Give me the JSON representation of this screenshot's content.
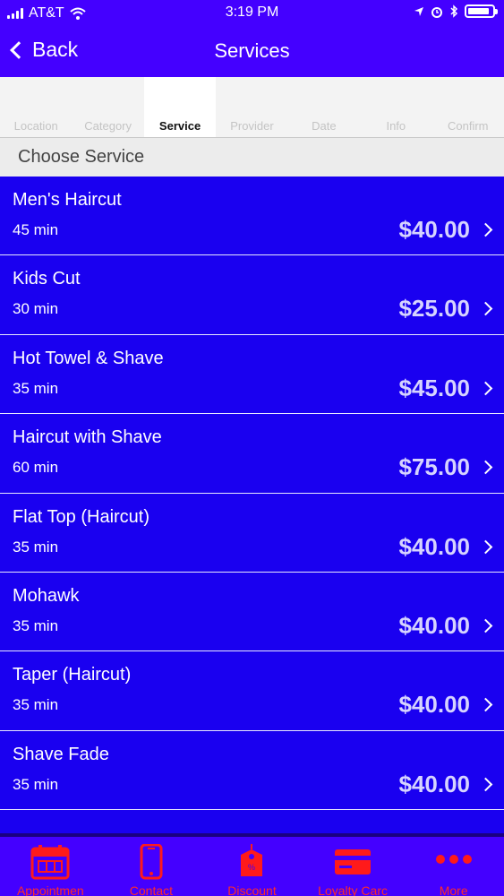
{
  "status_bar": {
    "carrier": "AT&T",
    "time": "3:19 PM",
    "battery_level": 0.9
  },
  "nav": {
    "back_label": "Back",
    "title": "Services"
  },
  "steps": [
    {
      "label": "Location",
      "active": false
    },
    {
      "label": "Category",
      "active": false
    },
    {
      "label": "Service",
      "active": true
    },
    {
      "label": "Provider",
      "active": false
    },
    {
      "label": "Date",
      "active": false
    },
    {
      "label": "Info",
      "active": false
    },
    {
      "label": "Confirm",
      "active": false
    }
  ],
  "section": {
    "title": "Choose Service"
  },
  "services": [
    {
      "name": "Men's Haircut",
      "duration": "45 min",
      "price": "$40.00"
    },
    {
      "name": "Kids Cut",
      "duration": "30 min",
      "price": "$25.00"
    },
    {
      "name": "Hot Towel & Shave",
      "duration": "35 min",
      "price": "$45.00"
    },
    {
      "name": "Haircut with Shave",
      "duration": "60 min",
      "price": "$75.00"
    },
    {
      "name": "Flat Top (Haircut)",
      "duration": "35 min",
      "price": "$40.00"
    },
    {
      "name": "Mohawk",
      "duration": "35 min",
      "price": "$40.00"
    },
    {
      "name": "Taper (Haircut)",
      "duration": "35 min",
      "price": "$40.00"
    },
    {
      "name": "Shave Fade",
      "duration": "35 min",
      "price": "$40.00"
    }
  ],
  "tabs": [
    {
      "label": "Appointmen",
      "icon": "calendar-icon"
    },
    {
      "label": "Contact",
      "icon": "phone-icon"
    },
    {
      "label": "Discount",
      "icon": "tag-icon"
    },
    {
      "label": "Loyalty Carc",
      "icon": "card-icon"
    },
    {
      "label": "More",
      "icon": "more-icon"
    }
  ],
  "colors": {
    "nav_purple": "#4400ff",
    "list_blue": "#1a00f0",
    "tab_red": "#ff1a1a"
  }
}
